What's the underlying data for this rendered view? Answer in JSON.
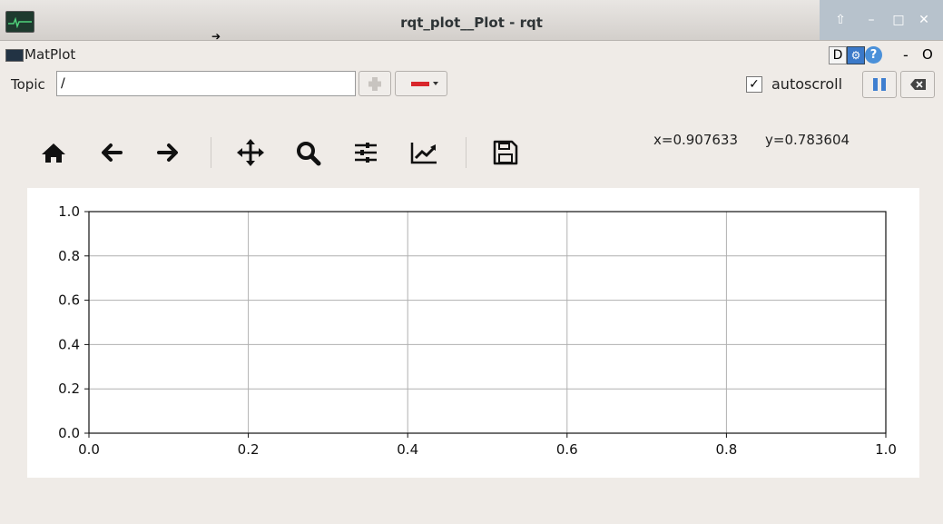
{
  "window": {
    "title": "rqt_plot__Plot - rqt",
    "controls": [
      "pin-icon",
      "minimize-icon",
      "maximize-icon",
      "close-icon"
    ]
  },
  "plugin": {
    "title": "MatPlot",
    "d_label": "D",
    "help_label": "?",
    "min_label": "-",
    "close_label": "O"
  },
  "topic": {
    "label": "Topic",
    "value": "/"
  },
  "autoscroll": {
    "label": "autoscroll",
    "checked": true
  },
  "toolbar": {
    "icons": [
      "home-icon",
      "back-icon",
      "forward-icon",
      "pan-icon",
      "zoom-icon",
      "subplots-config-icon",
      "edit-curves-icon",
      "save-icon"
    ],
    "coord_x": "x=0.907633",
    "coord_y": "y=0.783604"
  },
  "colors": {
    "remove_red": "#d9262b",
    "pause_blue": "#3f7fd0",
    "titlebar_controls": "#b7c2cc"
  },
  "chart_data": {
    "type": "line",
    "title": "",
    "xlabel": "",
    "ylabel": "",
    "series": [],
    "xlim": [
      0.0,
      1.0
    ],
    "ylim": [
      0.0,
      1.0
    ],
    "xticks": [
      "0.0",
      "0.2",
      "0.4",
      "0.6",
      "0.8",
      "1.0"
    ],
    "yticks": [
      "0.0",
      "0.2",
      "0.4",
      "0.6",
      "0.8",
      "1.0"
    ],
    "grid": true,
    "legend": "none"
  }
}
